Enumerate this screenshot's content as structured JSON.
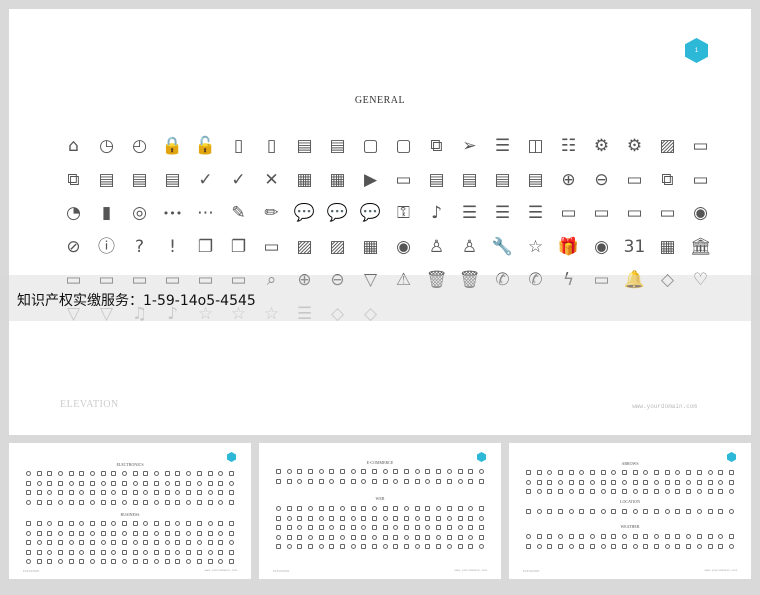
{
  "main_slide": {
    "badge": "1",
    "title": "GENERAL",
    "footer_left": "ELEVATION",
    "footer_right": "www.yourdomain.com",
    "icons": [
      [
        "home-icon",
        "⌂"
      ],
      [
        "clock-icon",
        "◷"
      ],
      [
        "clock-alt-icon",
        "◴"
      ],
      [
        "lock-icon",
        "🔒"
      ],
      [
        "unlock-icon",
        "🔓"
      ],
      [
        "notebook-icon",
        "▯"
      ],
      [
        "notebook-alt-icon",
        "▯"
      ],
      [
        "document-icon",
        "▤"
      ],
      [
        "documents-icon",
        "▤"
      ],
      [
        "file-icon",
        "▢"
      ],
      [
        "file-blank-icon",
        "▢"
      ],
      [
        "files-icon",
        "⧉"
      ],
      [
        "send-icon",
        "➢"
      ],
      [
        "sliders-icon",
        "☰"
      ],
      [
        "toggle-icon",
        "◫"
      ],
      [
        "equalizer-icon",
        "☷"
      ],
      [
        "gear-icon",
        "⚙"
      ],
      [
        "gear-alt-icon",
        "⚙"
      ],
      [
        "image-box-icon",
        "▨"
      ],
      [
        "monitor-icon",
        "▭"
      ],
      [
        "copy-icon",
        "⧉"
      ],
      [
        "note-icon",
        "▤"
      ],
      [
        "clipboard-icon",
        "▤"
      ],
      [
        "clipboard-alt-icon",
        "▤"
      ],
      [
        "check-icon",
        "✓"
      ],
      [
        "check-circle-icon",
        "✓"
      ],
      [
        "close-icon",
        "✕"
      ],
      [
        "film-icon",
        "▦"
      ],
      [
        "film-alt-icon",
        "▦"
      ],
      [
        "video-icon",
        "▶"
      ],
      [
        "receipt-icon",
        "▭"
      ],
      [
        "calendar-card-icon",
        "▤"
      ],
      [
        "id-card-icon",
        "▤"
      ],
      [
        "newspaper-icon",
        "▤"
      ],
      [
        "newspaper-alt-icon",
        "▤"
      ],
      [
        "plus-circle-icon",
        "⊕"
      ],
      [
        "minus-circle-icon",
        "⊖"
      ],
      [
        "bag-icon",
        "▭"
      ],
      [
        "folders-icon",
        "⧉"
      ],
      [
        "briefcase-icon",
        "▭"
      ],
      [
        "pie-chart-icon",
        "◔"
      ],
      [
        "bar-chart-icon",
        "▮"
      ],
      [
        "lifebuoy-icon",
        "◎"
      ],
      [
        "more-dots-icon",
        "•••"
      ],
      [
        "more-circle-icon",
        "⋯"
      ],
      [
        "edit-icon",
        "✎"
      ],
      [
        "pencil-icon",
        "✏"
      ],
      [
        "chat-icon",
        "💬"
      ],
      [
        "chat-dots-icon",
        "💬"
      ],
      [
        "chats-icon",
        "💬"
      ],
      [
        "key-icon",
        "⚿"
      ],
      [
        "guitar-icon",
        "♪"
      ],
      [
        "menu-icon",
        "☰"
      ],
      [
        "list-icon",
        "☰"
      ],
      [
        "list-alt-icon",
        "☰"
      ],
      [
        "folder-icon",
        "▭"
      ],
      [
        "folder-open-icon",
        "▭"
      ],
      [
        "folder-alt-icon",
        "▭"
      ],
      [
        "photo-folder-icon",
        "▭"
      ],
      [
        "user-circle-icon",
        "◉"
      ],
      [
        "ban-icon",
        "⊘"
      ],
      [
        "info-icon",
        "ⓘ"
      ],
      [
        "help-icon",
        "?"
      ],
      [
        "alert-circle-icon",
        "!"
      ],
      [
        "windows-icon",
        "❐"
      ],
      [
        "windows-alt-icon",
        "❐"
      ],
      [
        "layers-icon",
        "▭"
      ],
      [
        "picture-icon",
        "▨"
      ],
      [
        "pictures-icon",
        "▨"
      ],
      [
        "calculator-icon",
        "▦"
      ],
      [
        "profile-icon",
        "◉"
      ],
      [
        "user-icon",
        "♙"
      ],
      [
        "users-icon",
        "♙"
      ],
      [
        "wrench-icon",
        "🔧"
      ],
      [
        "star-badge-icon",
        "☆"
      ],
      [
        "gift-icon",
        "🎁"
      ],
      [
        "eye-icon",
        "◉"
      ],
      [
        "calendar-icon",
        "31"
      ],
      [
        "calendar-grid-icon",
        "▦"
      ],
      [
        "bank-icon",
        "🏛"
      ],
      [
        "archive-icon",
        "▭"
      ],
      [
        "archive-alt-icon",
        "▭"
      ],
      [
        "inbox-icon",
        "▭"
      ],
      [
        "package-icon",
        "▭"
      ],
      [
        "folder-tray-icon",
        "▭"
      ],
      [
        "box-icon",
        "▭"
      ],
      [
        "search-icon",
        "⌕"
      ],
      [
        "zoom-in-icon",
        "⊕"
      ],
      [
        "zoom-out-icon",
        "⊖"
      ],
      [
        "filter-icon",
        "▽"
      ],
      [
        "warning-icon",
        "⚠"
      ],
      [
        "trash-icon",
        "🗑"
      ],
      [
        "trash-alt-icon",
        "🗑"
      ],
      [
        "phone-icon",
        "✆"
      ],
      [
        "phone-ring-icon",
        "✆"
      ],
      [
        "flash-icon",
        "ϟ"
      ],
      [
        "browser-icon",
        "▭"
      ],
      [
        "bell-icon",
        "🔔"
      ],
      [
        "diamond-icon",
        "◇"
      ],
      [
        "heart-icon",
        "♡"
      ],
      [
        "filter-plus-icon",
        "▽"
      ],
      [
        "filter-minus-icon",
        "▽"
      ],
      [
        "music-icon",
        "♫"
      ],
      [
        "music-note-icon",
        "♪"
      ],
      [
        "star-icon",
        "☆"
      ],
      [
        "star-half-icon",
        "☆"
      ],
      [
        "star-circle-icon",
        "☆"
      ],
      [
        "checklist-icon",
        "☰"
      ],
      [
        "tag-icon",
        "◇"
      ],
      [
        "tags-icon",
        "◇"
      ]
    ]
  },
  "watermark": "知识产权实缴服务：1-59-14o5-4545",
  "thumbnails": [
    {
      "badge": "",
      "labels": [
        "ELECTRONICS",
        "BUSINESS"
      ],
      "footer_left": "ELEVATION",
      "footer_right": "www.yourdomain.com"
    },
    {
      "badge": "",
      "labels": [
        "E-COMMERCE",
        "WEB"
      ],
      "footer_left": "ELEVATION",
      "footer_right": "www.yourdomain.com"
    },
    {
      "badge": "",
      "labels": [
        "ARROWS",
        "LOCATION",
        "WEATHER"
      ],
      "footer_left": "ELEVATION",
      "footer_right": "www.yourdomain.com"
    }
  ],
  "colors": {
    "accent": "#2cb8d6",
    "icon": "#555555",
    "background": "#d9d9d9"
  }
}
